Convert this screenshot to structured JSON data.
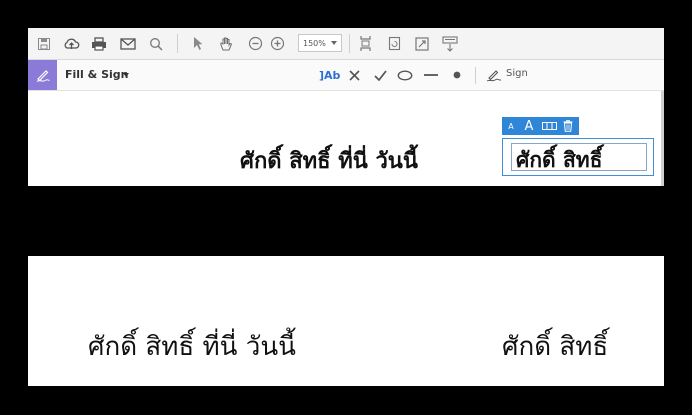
{
  "toolbar": {
    "icons": [
      "save-icon",
      "upload-icon",
      "print-icon",
      "email-icon",
      "search-icon",
      "pointer-icon",
      "hand-icon",
      "zoom-out-icon",
      "zoom-in-icon",
      "crop-icon",
      "rotate-icon",
      "fullscreen-icon",
      "scroll-mode-icon"
    ],
    "zoom_value": "150%"
  },
  "fill_sign": {
    "label": "Fill & Sign",
    "tools": {
      "text_label": "Ab",
      "sign_label": "Sign"
    },
    "accent_color": "#8b7ad8",
    "tool_accent": "#2d6fd1"
  },
  "document": {
    "line1": "ศักดิ์  สิทธิ์ ที่นี่ วันนี้",
    "field_text": "ศักดิ์ สิทธิ์",
    "mini_toolbar": {
      "small_a": "A",
      "large_a": "A"
    },
    "mini_toolbar_color": "#2f86d6"
  },
  "output": {
    "line1": "ศักดิ์  สิทธิ์ ที่นี่ วันนี้",
    "line2": "ศักดิ์ สิทธิ์"
  }
}
